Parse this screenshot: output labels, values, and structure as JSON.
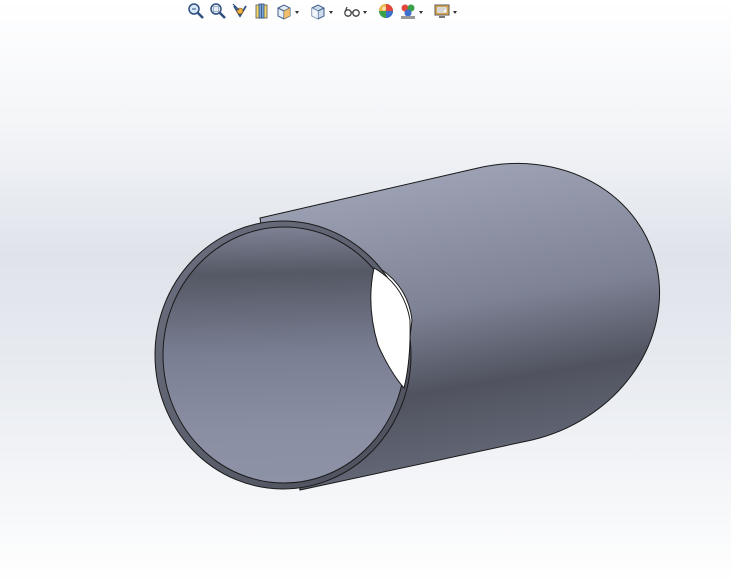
{
  "window": {
    "background_top": "#ffffff",
    "background_mid": "#dfe3ea"
  },
  "toolbar": {
    "items": [
      {
        "name": "zoom-to-fit",
        "icon": "magnifier-icon",
        "has_dropdown": false
      },
      {
        "name": "zoom-to-area",
        "icon": "zoom-area-icon",
        "has_dropdown": false
      },
      {
        "name": "previous-view",
        "icon": "previous-view-icon",
        "has_dropdown": false
      },
      {
        "name": "section-view",
        "icon": "section-view-icon",
        "has_dropdown": false
      },
      {
        "name": "view-orientation",
        "icon": "view-orientation-icon",
        "has_dropdown": true
      },
      {
        "name": "display-style",
        "icon": "display-style-cube-icon",
        "has_dropdown": true
      },
      {
        "name": "hide-show-items",
        "icon": "glasses-icon",
        "has_dropdown": true
      },
      {
        "name": "edit-appearance",
        "icon": "color-sphere-icon",
        "has_dropdown": false
      },
      {
        "name": "apply-scene",
        "icon": "scene-icon",
        "has_dropdown": true
      },
      {
        "name": "view-settings",
        "icon": "monitor-icon",
        "has_dropdown": true
      }
    ]
  },
  "model": {
    "part": "hollow-tube",
    "colors": {
      "outer_light": "#9ea2b5",
      "outer_dark": "#4f525e",
      "inner_dark": "#555965",
      "inner_light": "#8a8fa4",
      "edge": "#1a1a1a"
    }
  }
}
